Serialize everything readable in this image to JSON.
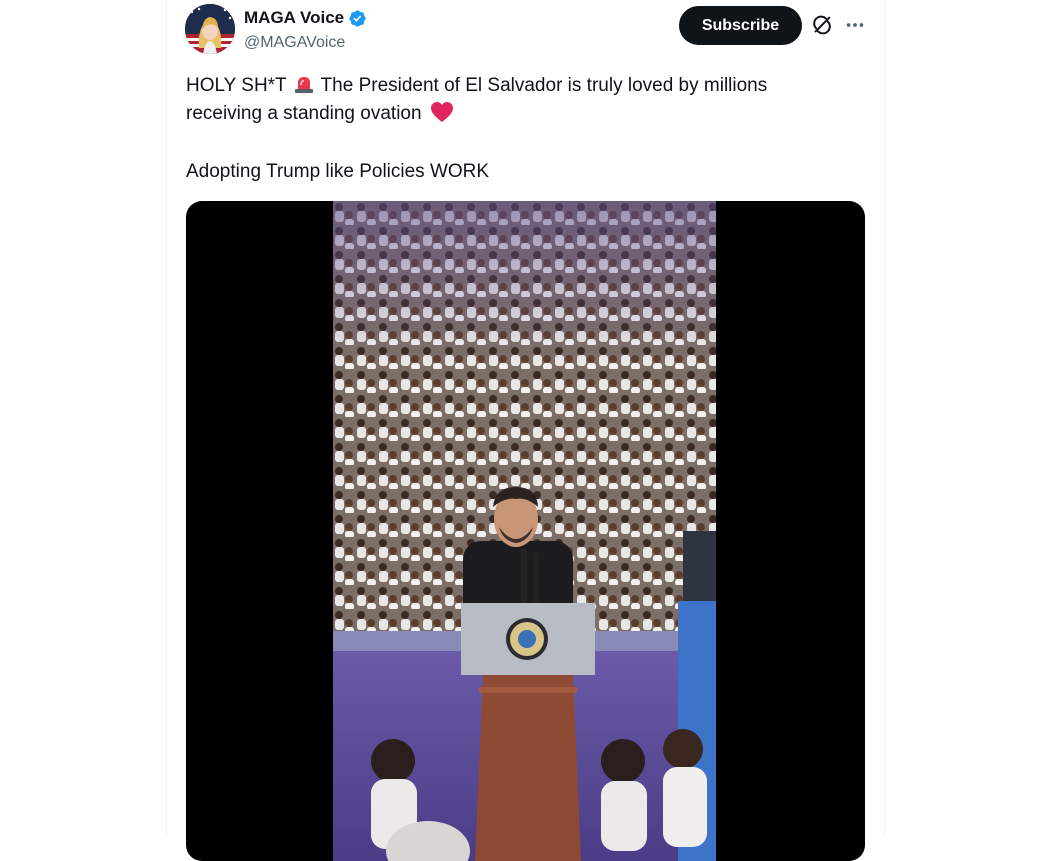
{
  "author": {
    "name": "MAGA Voice",
    "handle": "@MAGAVoice",
    "verified": true
  },
  "actions": {
    "subscribe_label": "Subscribe",
    "grok_icon": "grok-icon",
    "more_icon": "more-dots-icon"
  },
  "post": {
    "line1_a": "HOLY SH*T",
    "line1_b": "The President of El Salvador is truly loved by millions",
    "line2": "receiving a standing ovation",
    "line3": "Adopting Trump like Policies WORK",
    "emoji_1": "siren-emoji",
    "emoji_2": "red-heart-emoji"
  },
  "media": {
    "type": "video",
    "description_icon": "video-player"
  },
  "colors": {
    "text": "#0f1419",
    "secondary": "#536471",
    "verified": "#1d9bf0",
    "button_bg": "#0f1419",
    "heart": "#e0245e"
  }
}
